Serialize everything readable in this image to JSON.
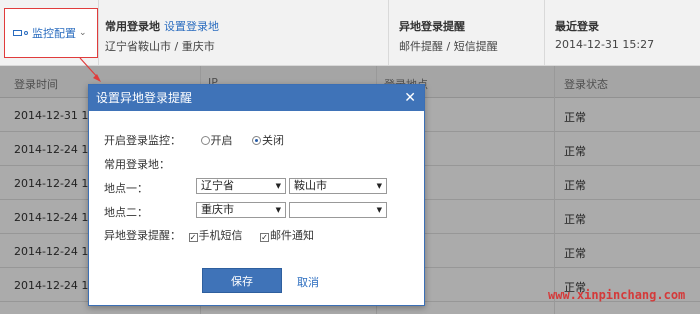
{
  "topbar": {
    "config_label": "监控配置",
    "common": {
      "title": "常用登录地",
      "link": "设置登录地",
      "value": "辽宁省鞍山市 / 重庆市"
    },
    "remote": {
      "title": "异地登录提醒",
      "value": "邮件提醒 / 短信提醒"
    },
    "last": {
      "title": "最近登录",
      "value": "2014-12-31 15:27"
    }
  },
  "table": {
    "headers": [
      "登录时间",
      "IP",
      "登录地点",
      "登录状态"
    ],
    "rows": [
      {
        "time": "2014-12-31 1",
        "status": "正常"
      },
      {
        "time": "2014-12-24 1",
        "status": "正常"
      },
      {
        "time": "2014-12-24 1",
        "status": "正常"
      },
      {
        "time": "2014-12-24 1",
        "status": "正常"
      },
      {
        "time": "2014-12-24 1",
        "status": "正常"
      },
      {
        "time": "2014-12-24 1",
        "status": "正常"
      }
    ]
  },
  "dialog": {
    "title": "设置异地登录提醒",
    "close": "✕",
    "monitor_label": "开启登录监控：",
    "opt_on": "开启",
    "opt_off": "关闭",
    "common_label": "常用登录地：",
    "loc1_label": "地点一：",
    "loc1_province": "辽宁省",
    "loc1_city": "鞍山市",
    "loc2_label": "地点二：",
    "loc2_province": "重庆市",
    "loc2_city": "",
    "remind_label": "异地登录提醒：",
    "sms_label": "手机短信",
    "mail_label": "邮件通知",
    "save": "保存",
    "cancel": "取消"
  },
  "watermark": "www.xinpinchang.com",
  "colors": {
    "accent": "#3f73b8",
    "link": "#2a6cbf",
    "highlight": "#e03c3c"
  }
}
